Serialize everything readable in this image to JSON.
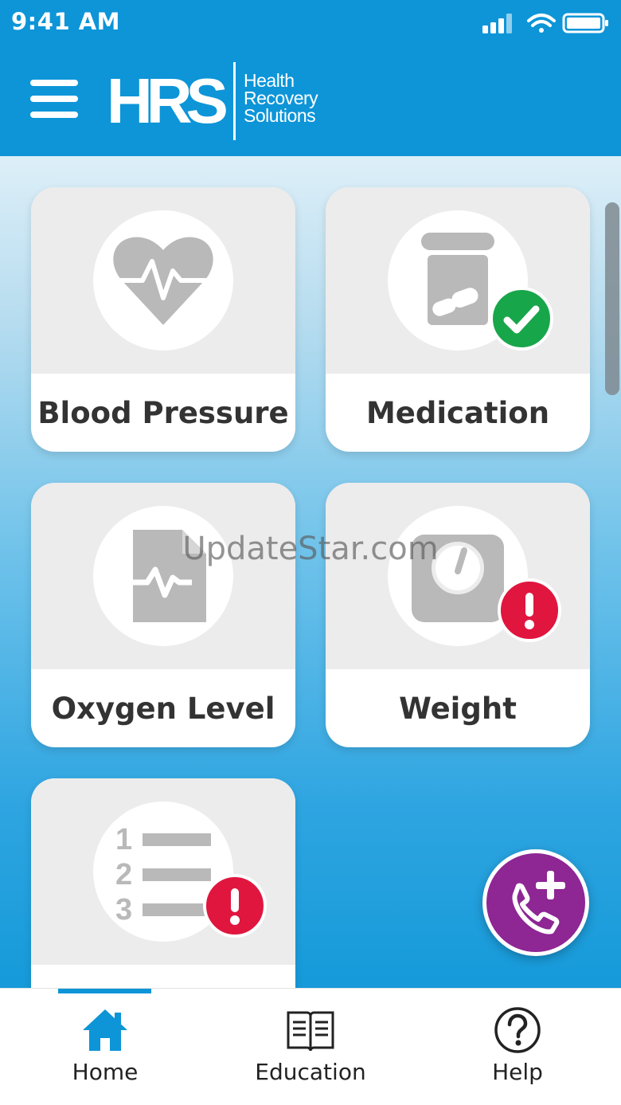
{
  "status_bar": {
    "time": "9:41 AM"
  },
  "header": {
    "logo_mark": "HRS",
    "logo_lines": [
      "Health",
      "Recovery",
      "Solutions"
    ],
    "brand_color": "#0d95d8"
  },
  "tiles": [
    {
      "label": "Blood Pressure",
      "icon": "heart-pulse-icon",
      "status": "none"
    },
    {
      "label": "Medication",
      "icon": "pill-bottle-icon",
      "status": "complete"
    },
    {
      "label": "Oxygen Level",
      "icon": "oxygen-document-icon",
      "status": "none"
    },
    {
      "label": "Weight",
      "icon": "scale-icon",
      "status": "alert"
    },
    {
      "label": "",
      "icon": "numbered-list-icon",
      "status": "alert"
    }
  ],
  "status_colors": {
    "complete": "#18a64a",
    "alert": "#e0163f"
  },
  "fab": {
    "icon": "add-call-icon",
    "color": "#8e2694"
  },
  "watermark": "UpdateStar.com",
  "tabs": [
    {
      "label": "Home",
      "icon": "home-icon",
      "active": true
    },
    {
      "label": "Education",
      "icon": "book-icon",
      "active": false
    },
    {
      "label": "Help",
      "icon": "help-icon",
      "active": false
    }
  ]
}
